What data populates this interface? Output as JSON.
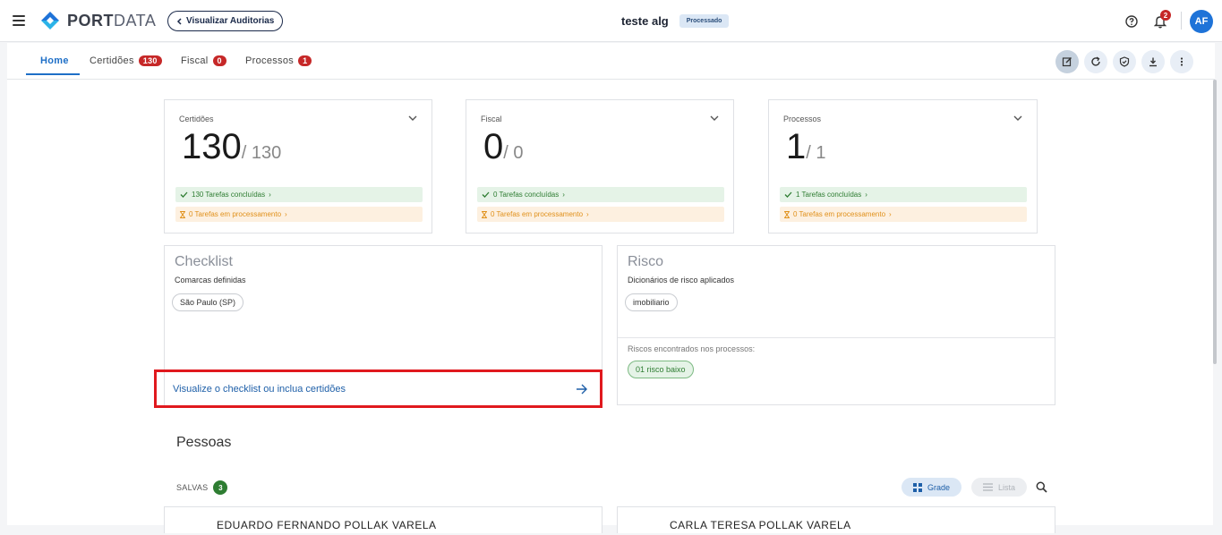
{
  "header": {
    "logo_text_bold": "PORT",
    "logo_text_light": "DATA",
    "back_label": "Visualizar Auditorias",
    "title": "teste alg",
    "status": "Processado",
    "notification_count": "2",
    "avatar_initials": "AF"
  },
  "tabs": [
    {
      "label": "Home",
      "active": true
    },
    {
      "label": "Certidões",
      "count": "130"
    },
    {
      "label": "Fiscal",
      "count": "0"
    },
    {
      "label": "Processos",
      "count": "1"
    }
  ],
  "toolbar": {
    "icons": [
      "edit-icon",
      "refresh-icon",
      "shield-icon",
      "download-icon",
      "more-icon"
    ]
  },
  "stats": [
    {
      "label": "Certidões",
      "value": "130",
      "total": "/ 130",
      "done": "130 Tarefas concluídas",
      "processing": "0 Tarefas em processamento"
    },
    {
      "label": "Fiscal",
      "value": "0",
      "total": "/ 0",
      "done": "0 Tarefas concluídas",
      "processing": "0 Tarefas em processamento"
    },
    {
      "label": "Processos",
      "value": "1",
      "total": "/ 1",
      "done": "1 Tarefas concluídas",
      "processing": "0 Tarefas em processamento"
    }
  ],
  "checklist": {
    "title": "Checklist",
    "subtitle": "Comarcas definidas",
    "chip": "São Paulo (SP)",
    "link": "Visualize o checklist ou inclua certidões"
  },
  "risco": {
    "title": "Risco",
    "subtitle": "Dicionários de risco aplicados",
    "chip": "imobiliario",
    "found_label": "Riscos encontrados nos processos:",
    "found_chip": "01 risco baixo"
  },
  "pessoas": {
    "title": "Pessoas",
    "saved_label": "SALVAS",
    "saved_count": "3",
    "view_grid": "Grade",
    "view_list": "Lista",
    "people": [
      "EDUARDO FERNANDO POLLAK VARELA",
      "CARLA TERESA POLLAK VARELA"
    ]
  },
  "colors": {
    "primary": "#1e6fc7",
    "badge_red": "#c62828",
    "success_green": "#2e7d32",
    "warning_orange": "#e0901a",
    "highlight_red": "#e0191e"
  }
}
